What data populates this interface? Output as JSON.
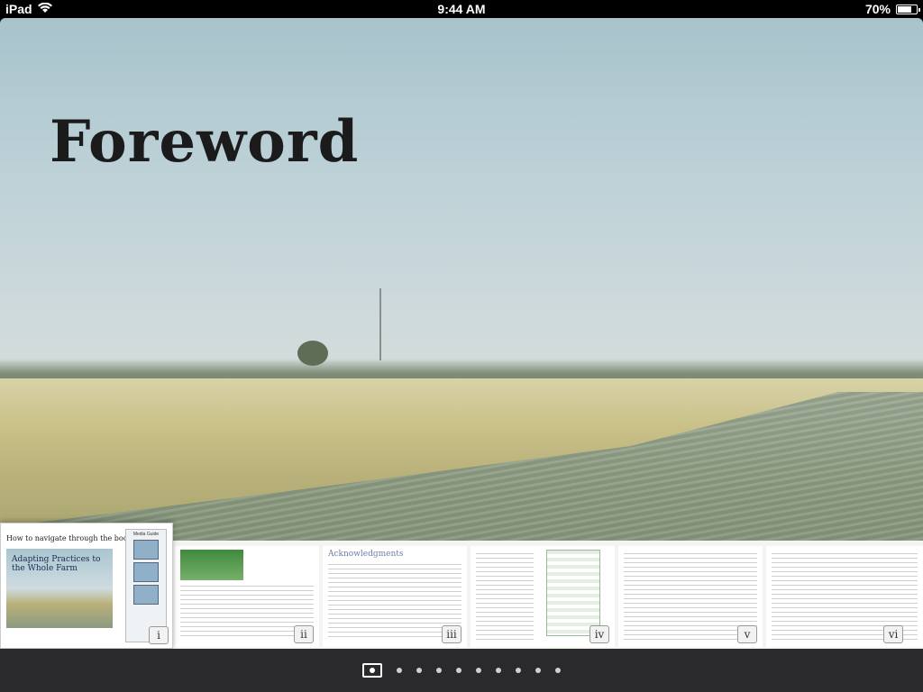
{
  "status_bar": {
    "device": "iPad",
    "time": "9:44 AM",
    "battery": "70%",
    "battery_level": 0.7
  },
  "page": {
    "title": "Foreword"
  },
  "thumbnails": {
    "cover": {
      "heading": "How to navigate through the book:",
      "image_title": "Adapting Practices to the Whole Farm",
      "side_title": "Media Guide",
      "page_label": "i"
    },
    "pages": [
      {
        "label": "ii",
        "heading": ""
      },
      {
        "label": "iii",
        "heading": "Acknowledgments"
      },
      {
        "label": "iv",
        "heading": ""
      },
      {
        "label": "v",
        "heading": ""
      },
      {
        "label": "vi",
        "heading": ""
      }
    ]
  },
  "page_indicator": {
    "total": 10,
    "current": 1
  }
}
